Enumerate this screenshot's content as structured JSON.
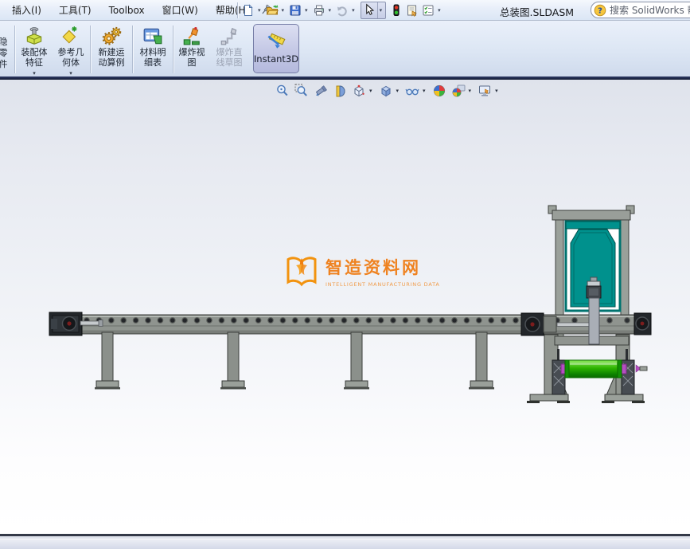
{
  "window": {
    "title": "总装图.SLDASM"
  },
  "menu": {
    "items": [
      "插入(I)",
      "工具(T)",
      "Toolbox",
      "窗口(W)",
      "帮助(H)"
    ]
  },
  "quick_toolbar": {
    "icons": [
      "new-document",
      "open",
      "save",
      "print",
      "undo",
      "select-cursor",
      "traffic-light",
      "properties",
      "options"
    ]
  },
  "search": {
    "text": "搜索 SolidWorks 帮助"
  },
  "icons": {
    "caret": "▾",
    "question": "?"
  },
  "ribbon": {
    "hide_components": {
      "l1": "隐",
      "l2": "零",
      "l3": "件"
    },
    "assembly_features": {
      "l1": "装配体",
      "l2": "特征"
    },
    "reference_geometry": {
      "l1": "参考几",
      "l2": "何体"
    },
    "new_motion_study": {
      "l1": "新建运",
      "l2": "动算例"
    },
    "bill_of_materials": {
      "l1": "材料明",
      "l2": "细表"
    },
    "exploded_view": {
      "l1": "爆炸视",
      "l2": "图"
    },
    "explode_line_sketch": {
      "l1": "爆炸直",
      "l2": "线草图"
    },
    "instant3d": {
      "label": "Instant3D"
    }
  },
  "view_toolbar": {
    "icons": [
      "zoom-to-fit",
      "zoom-to-area",
      "previous-view",
      "section-view",
      "view-orientation",
      "display-style",
      "hide-show-items",
      "edit-appearance",
      "apply-scene",
      "view-settings"
    ]
  },
  "watermark": {
    "title": "智造资料网",
    "subtitle": "INTELLIGENT MANUFACTURING DATA",
    "color": "#ef8220"
  },
  "colors": {
    "ribbon_active_bg": "#c2c6e4",
    "ribbon_edge": "#121a33",
    "teal_panel": "#00918d",
    "roller_green": "#2eb400",
    "metal_gray": "#8f948f",
    "bearing_magenta": "#b44fc0",
    "statusbar_bg": "#d4d9e8"
  }
}
